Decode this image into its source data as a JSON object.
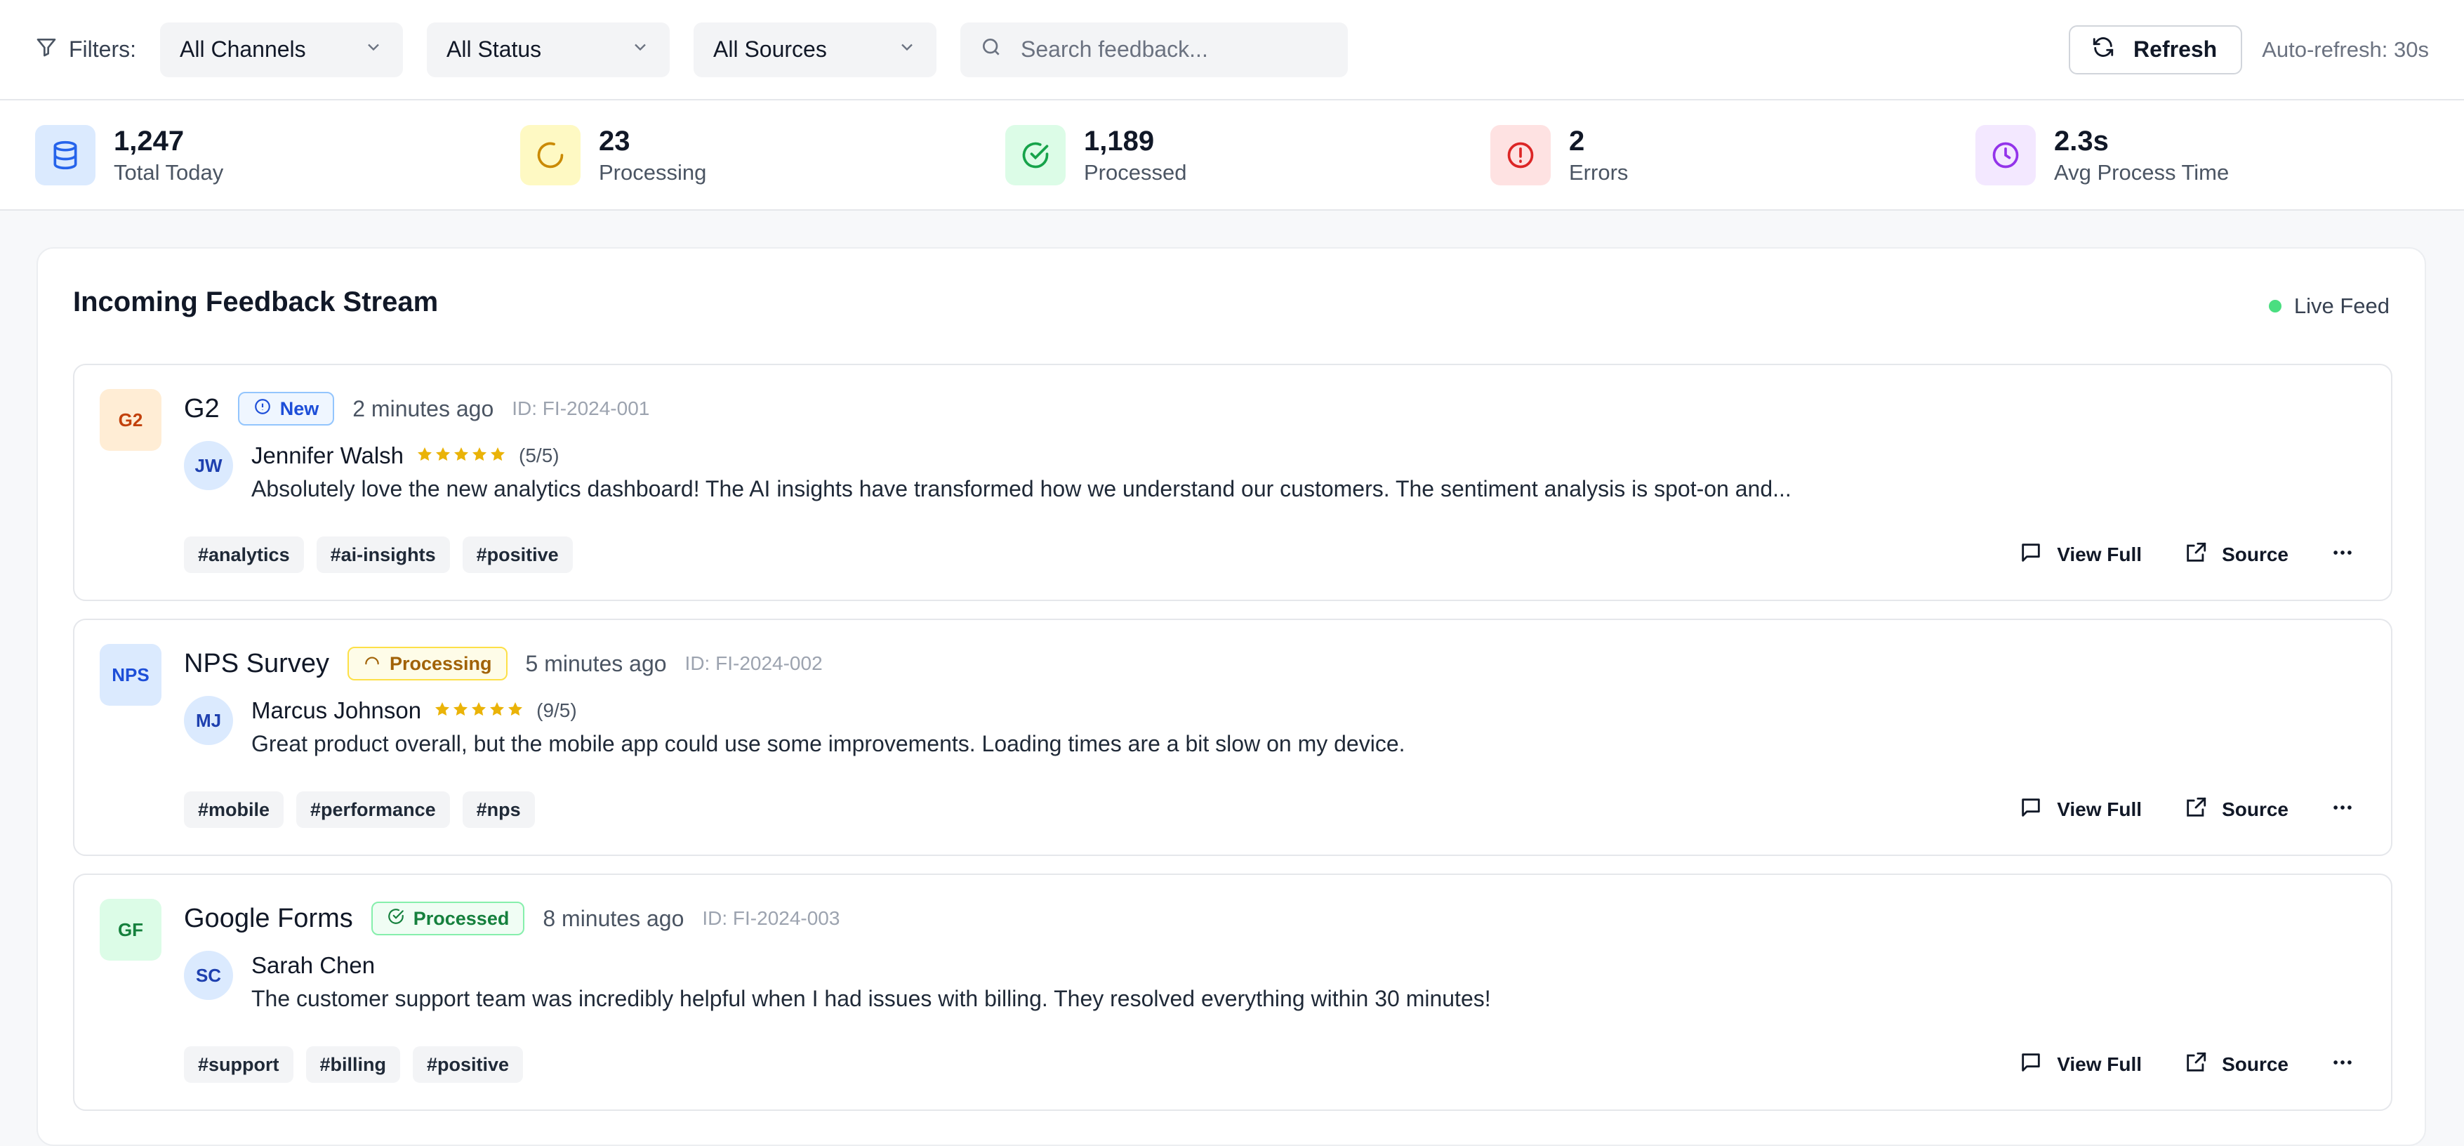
{
  "filters": {
    "label": "Filters:",
    "channel": "All Channels",
    "status": "All Status",
    "sources": "All Sources",
    "search_placeholder": "Search feedback...",
    "refresh_label": "Refresh",
    "auto_refresh": "Auto-refresh: 30s"
  },
  "stats": [
    {
      "value": "1,247",
      "label": "Total Today",
      "icon": "database-icon",
      "bg": "#dbeafe",
      "fg": "#2563eb"
    },
    {
      "value": "23",
      "label": "Processing",
      "icon": "loader-icon",
      "bg": "#fef9c3",
      "fg": "#ca8a04"
    },
    {
      "value": "1,189",
      "label": "Processed",
      "icon": "check-circle-icon",
      "bg": "#dcfce7",
      "fg": "#16a34a"
    },
    {
      "value": "2",
      "label": "Errors",
      "icon": "alert-circle-icon",
      "bg": "#fee2e2",
      "fg": "#dc2626"
    },
    {
      "value": "2.3s",
      "label": "Avg Process Time",
      "icon": "clock-icon",
      "bg": "#f3e8ff",
      "fg": "#9333ea"
    }
  ],
  "stream": {
    "title": "Incoming Feedback Stream",
    "live_label": "Live Feed",
    "items": [
      {
        "source_abbr": "G2",
        "source_name": "G2",
        "badge_bg": "#ffedd5",
        "badge_fg": "#c2410c",
        "status": "New",
        "status_style": "new",
        "time": "2 minutes ago",
        "id": "ID: FI-2024-001",
        "initials": "JW",
        "author": "Jennifer Walsh",
        "stars": 5,
        "rating": "(5/5)",
        "text": "Absolutely love the new analytics dashboard! The AI insights have transformed how we understand our customers. The sentiment analysis is spot-on and...",
        "tags": [
          "#analytics",
          "#ai-insights",
          "#positive"
        ],
        "view_full": "View Full",
        "source_link": "Source"
      },
      {
        "source_abbr": "NPS",
        "source_name": "NPS Survey",
        "badge_bg": "#dbeafe",
        "badge_fg": "#1d4ed8",
        "status": "Processing",
        "status_style": "processing",
        "time": "5 minutes ago",
        "id": "ID: FI-2024-002",
        "initials": "MJ",
        "author": "Marcus Johnson",
        "stars": 5,
        "rating": "(9/5)",
        "text": "Great product overall, but the mobile app could use some improvements. Loading times are a bit slow on my device.",
        "tags": [
          "#mobile",
          "#performance",
          "#nps"
        ],
        "view_full": "View Full",
        "source_link": "Source"
      },
      {
        "source_abbr": "GF",
        "source_name": "Google Forms",
        "badge_bg": "#dcfce7",
        "badge_fg": "#15803d",
        "status": "Processed",
        "status_style": "processed",
        "time": "8 minutes ago",
        "id": "ID: FI-2024-003",
        "initials": "SC",
        "author": "Sarah Chen",
        "stars": 0,
        "rating": "",
        "text": "The customer support team was incredibly helpful when I had issues with billing. They resolved everything within 30 minutes!",
        "tags": [
          "#support",
          "#billing",
          "#positive"
        ],
        "view_full": "View Full",
        "source_link": "Source"
      }
    ]
  }
}
